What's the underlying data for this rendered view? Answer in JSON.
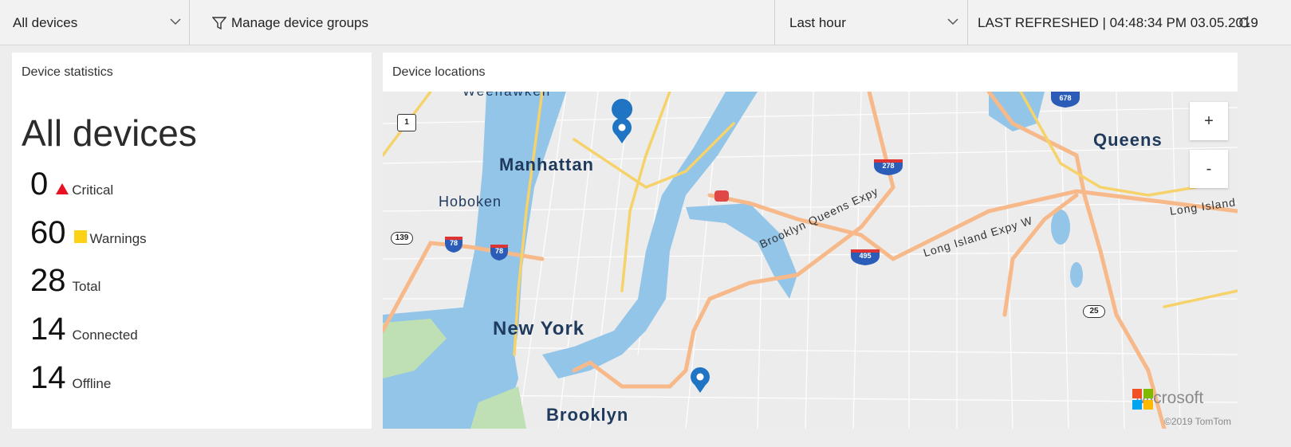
{
  "toolbar": {
    "device_filter": "All devices",
    "manage_groups": "Manage device groups",
    "time_range": "Last hour",
    "last_refreshed": "LAST REFRESHED | 04:48:34 PM 03.05.2019"
  },
  "stats_panel": {
    "title": "Device statistics",
    "heading": "All devices",
    "rows": [
      {
        "value": "0",
        "label": "Critical",
        "icon": "critical-triangle-icon",
        "color": "#e81123"
      },
      {
        "value": "60",
        "label": "Warnings",
        "icon": "warning-square-icon",
        "color": "#fcd116"
      },
      {
        "value": "28",
        "label": "Total"
      },
      {
        "value": "14",
        "label": "Connected"
      },
      {
        "value": "14",
        "label": "Offline"
      }
    ]
  },
  "map_panel": {
    "title": "Device locations",
    "zoom_in": "+",
    "zoom_out": "-",
    "labels": {
      "manhattan": "Manhattan",
      "hoboken": "Hoboken",
      "new_york": "New York",
      "brooklyn": "Brooklyn",
      "queens": "Queens",
      "weehawken": "Weehawken",
      "bqe": "Brooklyn Queens Expy",
      "lie": "Long Island Expy W",
      "long_island": "Long Island"
    },
    "shields": [
      "1",
      "139",
      "78",
      "78",
      "278",
      "495",
      "678",
      "25"
    ],
    "brand": "Microsoft",
    "copyright": "©2019 TomTom"
  },
  "colors": {
    "water": "#92c5e8",
    "highway": "#f7b98a",
    "major_road": "#f6d26b",
    "pin": "#1f74c4",
    "accent_red": "#e81123"
  }
}
